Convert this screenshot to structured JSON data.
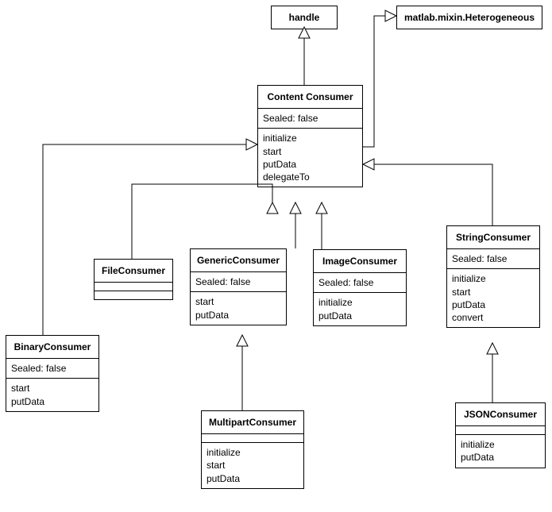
{
  "classes": {
    "handle": {
      "name": "handle"
    },
    "heterogeneous": {
      "name": "matlab.mixin.Heterogeneous"
    },
    "contentConsumer": {
      "name": "Content Consumer",
      "attr1": "Sealed: false",
      "m1": "initialize",
      "m2": "start",
      "m3": "putData",
      "m4": "delegateTo"
    },
    "fileConsumer": {
      "name": "FileConsumer"
    },
    "genericConsumer": {
      "name": "GenericConsumer",
      "attr1": "Sealed: false",
      "m1": "start",
      "m2": "putData"
    },
    "imageConsumer": {
      "name": "ImageConsumer",
      "attr1": "Sealed: false",
      "m1": "initialize",
      "m2": "putData"
    },
    "stringConsumer": {
      "name": "StringConsumer",
      "attr1": "Sealed: false",
      "m1": "initialize",
      "m2": "start",
      "m3": "putData",
      "m4": "convert"
    },
    "binaryConsumer": {
      "name": "BinaryConsumer",
      "attr1": "Sealed: false",
      "m1": "start",
      "m2": "putData"
    },
    "multipartConsumer": {
      "name": "MultipartConsumer",
      "m1": "initialize",
      "m2": "start",
      "m3": "putData"
    },
    "jsonConsumer": {
      "name": "JSONConsumer",
      "m1": "initialize",
      "m2": "putData"
    }
  }
}
